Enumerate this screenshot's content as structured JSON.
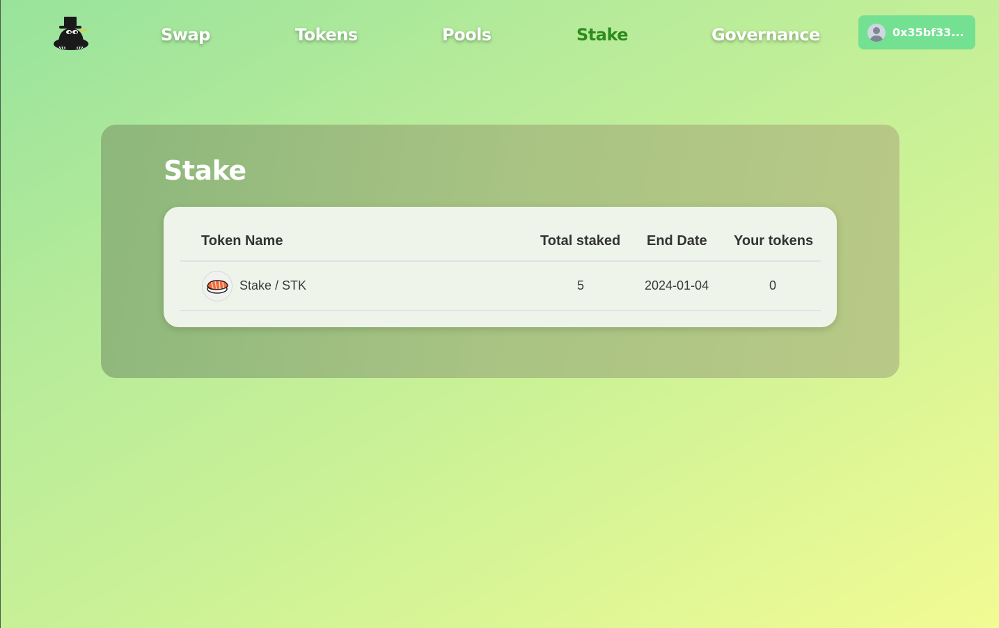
{
  "nav": {
    "links": [
      "Swap",
      "Tokens",
      "Pools",
      "Stake",
      "Governance"
    ],
    "active": "Stake"
  },
  "wallet": {
    "address": "0x35bf33..."
  },
  "stake": {
    "title": "Stake",
    "columns": [
      "Token Name",
      "Total staked",
      "End Date",
      "Your tokens"
    ],
    "rows": [
      {
        "token": "Stake / STK",
        "icon": "sushi-icon",
        "total_staked": "5",
        "end_date": "2024-01-04",
        "your_tokens": "0"
      }
    ]
  },
  "colors": {
    "active_link": "#2e8b1e",
    "wallet_button": "#74e091",
    "panel": "#a8c383",
    "card": "#eff4eb"
  }
}
